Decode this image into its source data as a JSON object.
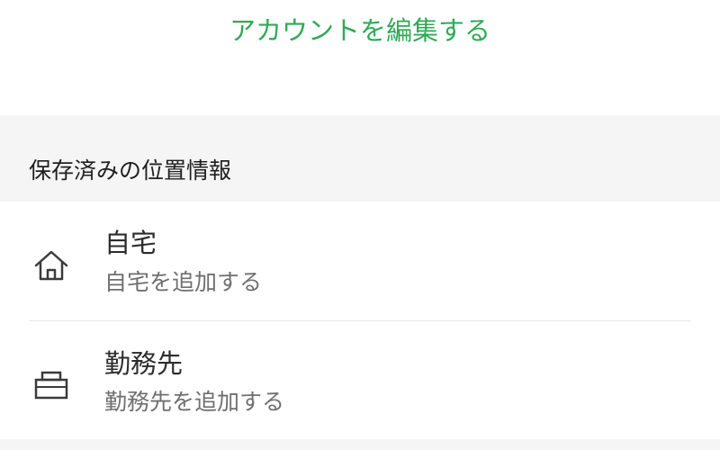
{
  "account": {
    "edit_label": "アカウントを編集する"
  },
  "saved_locations": {
    "section_title": "保存済みの位置情報",
    "items": [
      {
        "title": "自宅",
        "subtitle": "自宅を追加する",
        "icon": "home-icon"
      },
      {
        "title": "勤務先",
        "subtitle": "勤務先を追加する",
        "icon": "briefcase-icon"
      }
    ]
  },
  "colors": {
    "accent": "#2faa55",
    "section_background": "#f5f5f5",
    "title_text": "#2c2c2c",
    "subtitle_text": "#6f6f6f",
    "divider": "#e6e6e6"
  }
}
